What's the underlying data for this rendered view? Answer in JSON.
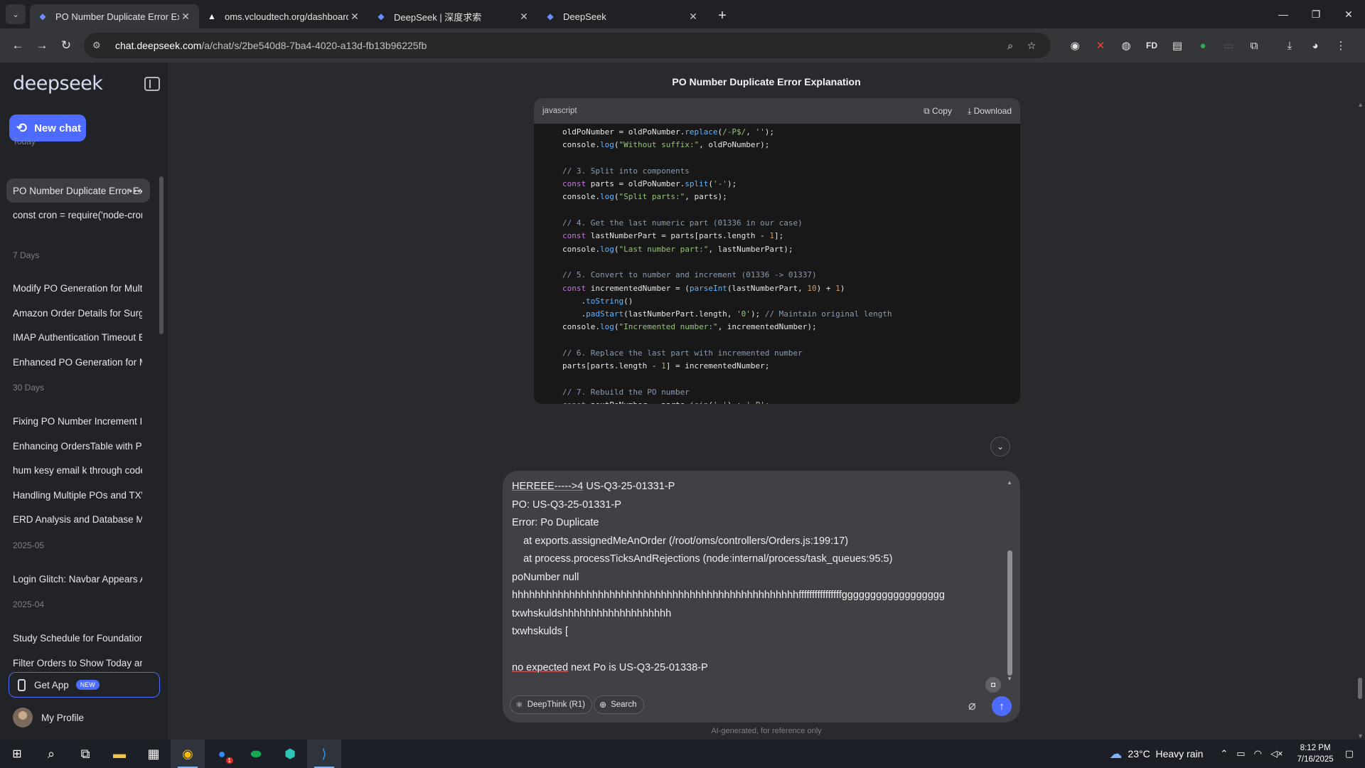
{
  "browser": {
    "tabs": [
      {
        "title": "PO Number Duplicate Error Exp",
        "active": true
      },
      {
        "title": "oms.vcloudtech.org/dashboard",
        "active": false
      },
      {
        "title": "DeepSeek | 深度求索",
        "active": false
      },
      {
        "title": "DeepSeek",
        "active": false
      }
    ],
    "url_host": "chat.deepseek.com",
    "url_path": "/a/chat/s/2be540d8-7ba4-4020-a13d-fb13b96225fb"
  },
  "sidebar": {
    "logo": "deepseek",
    "new_chat_label": "New chat",
    "sections": [
      {
        "label": "Today",
        "items": [
          "PO Number Duplicate Error Explanation",
          "const cron = require('node-cron"
        ]
      },
      {
        "label": "7 Days",
        "items": [
          "Modify PO Generation for Multiple",
          "Amazon Order Details for Surge",
          "IMAP Authentication Timeout Err",
          "Enhanced PO Generation for Mu"
        ]
      },
      {
        "label": "30 Days",
        "items": [
          "Fixing PO Number Increment Iss",
          "Enhancing OrdersTable with Pro",
          "hum kesy email k through code",
          "Handling Multiple POs and TXW",
          "ERD Analysis and Database Mod"
        ]
      },
      {
        "label": "2025-05",
        "items": [
          "Login Glitch: Navbar Appears Ab"
        ]
      },
      {
        "label": "2025-04",
        "items": [
          "Study Schedule for Foundation U",
          "Filter Orders to Show Today and"
        ]
      }
    ],
    "get_app_label": "Get App",
    "get_app_badge": "NEW",
    "profile_label": "My Profile"
  },
  "chat": {
    "title": "PO Number Duplicate Error Explanation",
    "code": {
      "language": "javascript",
      "copy_label": "Copy",
      "download_label": "Download"
    },
    "composer_text": {
      "l1a": "HEREEE----->4",
      "l1b": " US-Q3-25-01331-P",
      "l2": "PO: US-Q3-25-01331-P",
      "l3": "Error: Po Duplicate",
      "l4": "    at exports.assignedMeAnOrder (/root/oms/controllers/Orders.js:199:17)",
      "l5": "    at process.processTicksAndRejections (node:internal/process/task_queues:95:5)",
      "l6": "poNumber null",
      "l7": "hhhhhhhhhhhhhhhhhhhhhhhhhhhhhhhhhhhhhhhhhhhhhhhhhhffffffffffffffffgggggggggggggggggg",
      "l8": "txwhskuldshhhhhhhhhhhhhhhhhhh",
      "l9": "txwhskulds [",
      "l10a": "no expected",
      "l10b": " next Po is US-Q3-25-01338-P"
    },
    "deepthink_label": "DeepThink (R1)",
    "search_label": "Search",
    "disclaimer": "AI-generated, for reference only"
  },
  "taskbar": {
    "weather_temp": "23°C",
    "weather_text": "Heavy rain",
    "time": "8:12 PM",
    "date": "7/16/2025",
    "zoom_badge": "1"
  }
}
